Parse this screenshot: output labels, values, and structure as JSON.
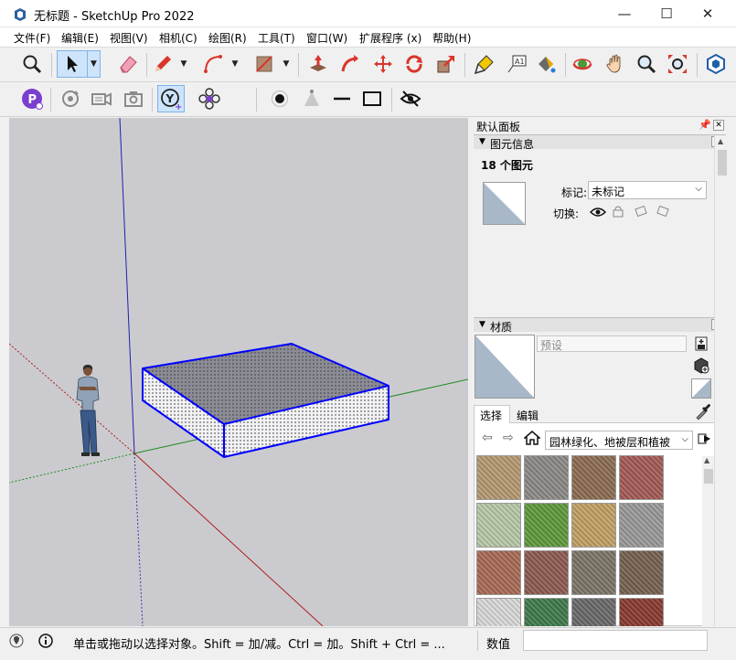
{
  "window": {
    "title": "无标题 - SketchUp Pro 2022",
    "minimize_glyph": "—",
    "maximize_glyph": "☐",
    "close_glyph": "✕"
  },
  "menu": [
    "文件(F)",
    "编辑(E)",
    "视图(V)",
    "相机(C)",
    "绘图(R)",
    "工具(T)",
    "窗口(W)",
    "扩展程序 (x)",
    "帮助(H)"
  ],
  "toolbar_primary": [
    {
      "name": "zoom-window-icon"
    },
    {
      "name": "select-icon",
      "active": true
    },
    {
      "name": "eraser-icon"
    },
    {
      "name": "pencil-line-icon"
    },
    {
      "name": "arc-icon"
    },
    {
      "name": "rectangle-icon"
    },
    {
      "name": "push-pull-icon"
    },
    {
      "name": "follow-me-icon"
    },
    {
      "name": "move-icon"
    },
    {
      "name": "rotate-icon"
    },
    {
      "name": "scale-icon"
    },
    {
      "name": "tape-measure-icon"
    },
    {
      "name": "text-icon"
    },
    {
      "name": "paint-bucket-icon"
    },
    {
      "name": "orbit-icon"
    },
    {
      "name": "pan-icon"
    },
    {
      "name": "zoom-icon"
    },
    {
      "name": "zoom-extents-icon"
    },
    {
      "name": "extension-warehouse-icon"
    }
  ],
  "toolbar_secondary": [
    {
      "name": "profile-builder-icon"
    },
    {
      "name": "rotate-view-icon"
    },
    {
      "name": "camera-video-icon"
    },
    {
      "name": "screenshot-icon"
    },
    {
      "name": "y-axis-add-icon",
      "active": true
    },
    {
      "name": "flower-icon"
    },
    {
      "name": "point-icon"
    },
    {
      "name": "cone-icon"
    },
    {
      "name": "line-icon"
    },
    {
      "name": "square-icon"
    },
    {
      "name": "hide-icon"
    }
  ],
  "panel": {
    "title": "默认面板",
    "entity_info": {
      "header": "图元信息",
      "count_label": "18 个图元",
      "tag_label": "标记:",
      "tag_value": "未标记",
      "toggle_label": "切换:"
    },
    "materials": {
      "header": "材质",
      "name_placeholder": "预设",
      "tab_select": "选择",
      "tab_edit": "编辑",
      "library_value": "园林绿化、地被层和植被",
      "swatches": [
        {
          "name": "gravel-tan",
          "color": "#b59a72"
        },
        {
          "name": "gravel-grey",
          "color": "#8b8a86"
        },
        {
          "name": "river-stones",
          "color": "#8c6c50"
        },
        {
          "name": "red-brick-pavers",
          "color": "#a55a55"
        },
        {
          "name": "stone-path-grass",
          "color": "#b8c8a8"
        },
        {
          "name": "grass",
          "color": "#5f9a3a"
        },
        {
          "name": "sand",
          "color": "#c2a064"
        },
        {
          "name": "wood-fence",
          "color": "#9a9a9a"
        },
        {
          "name": "red-stone",
          "color": "#a86a56"
        },
        {
          "name": "red-gravel",
          "color": "#8e5a50"
        },
        {
          "name": "mixed-pebbles",
          "color": "#7b7468"
        },
        {
          "name": "dark-gravel",
          "color": "#76614e"
        },
        {
          "name": "fence-boards",
          "color": "#d9d9d9"
        },
        {
          "name": "green-stones",
          "color": "#3f7a4a"
        },
        {
          "name": "cobblestone-grey",
          "color": "#6a6a6a"
        },
        {
          "name": "red-tile",
          "color": "#8a3a30"
        }
      ]
    }
  },
  "status": {
    "hint": "单击或拖动以选择对象。Shift = 加/减。Ctrl = 加。Shift + Ctrl = ...",
    "measurements_label": "数值"
  },
  "colors": {
    "selection_blue": "#0000ff",
    "viewport_bg": "#cbcbcf",
    "top_face": "#8c8c96",
    "side_face": "#f2f2f4"
  }
}
